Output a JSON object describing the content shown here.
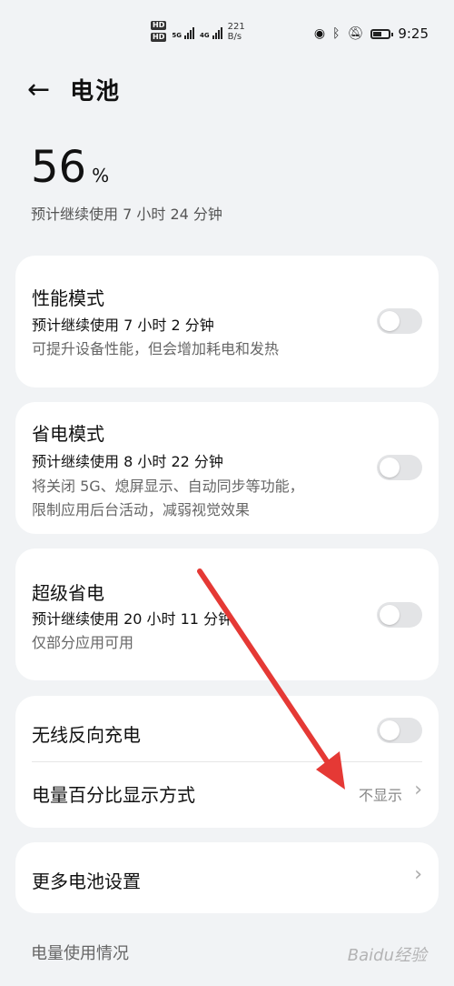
{
  "status_bar": {
    "network": "5G",
    "network2": "4G",
    "speed_value": "221",
    "speed_unit": "B/s",
    "time": "9:25",
    "battery_level": 0.56
  },
  "header": {
    "back_icon": "arrow-left-icon",
    "title": "电池"
  },
  "battery": {
    "percent": "56",
    "unit": "%",
    "remaining": "预计继续使用 7 小时 24 分钟"
  },
  "performance_mode": {
    "title": "性能模式",
    "estimate": "预计继续使用 7 小时 2 分钟",
    "description": "可提升设备性能，但会增加耗电和发热",
    "enabled": false
  },
  "power_saving_mode": {
    "title": "省电模式",
    "estimate": "预计继续使用 8 小时 22 分钟",
    "description_line1": "将关闭 5G、熄屏显示、自动同步等功能，",
    "description_line2": "限制应用后台活动，减弱视觉效果",
    "enabled": false
  },
  "super_saving": {
    "title": "超级省电",
    "estimate": "预计继续使用 20 小时 11 分钟",
    "description": "仅部分应用可用",
    "enabled": false
  },
  "wireless_reverse": {
    "title": "无线反向充电",
    "enabled": false
  },
  "percentage_display": {
    "title": "电量百分比显示方式",
    "value": "不显示"
  },
  "more_settings": {
    "title": "更多电池设置"
  },
  "usage_section": {
    "title": "电量使用情况"
  },
  "watermark": "Baidu经验",
  "annotation": {
    "arrow_color": "#e53935"
  }
}
